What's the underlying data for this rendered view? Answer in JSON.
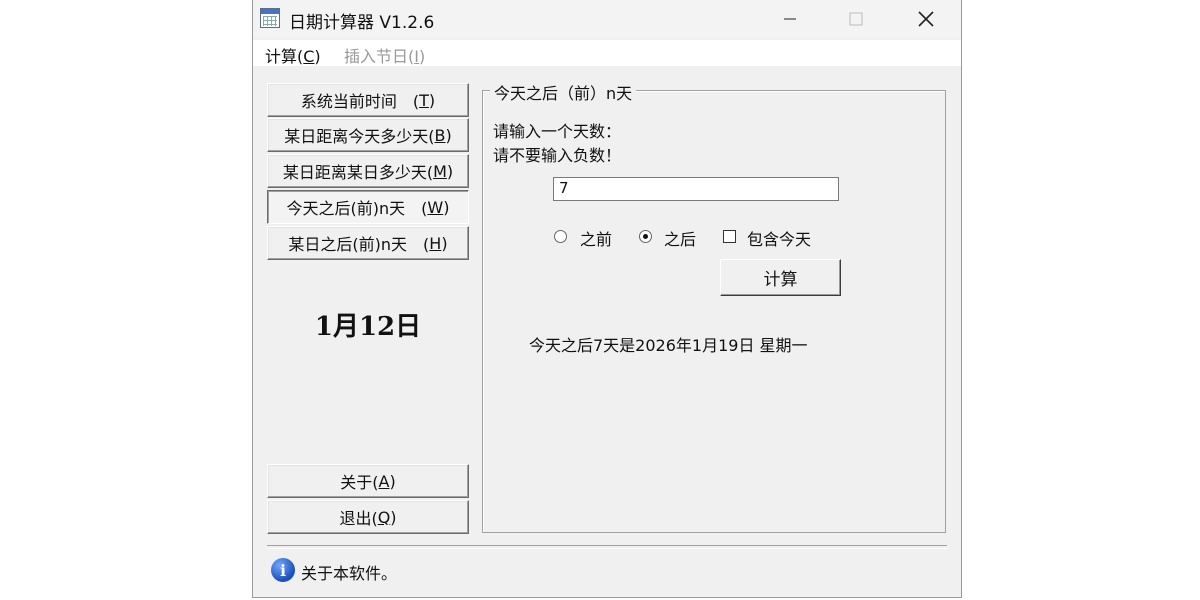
{
  "window": {
    "title": "日期计算器  V1.2.6",
    "icon": "calendar-app-icon",
    "controls": {
      "minimize": "—",
      "maximize": "☐",
      "close": "✕"
    }
  },
  "menu": {
    "calc_text": "计算(",
    "calc_key": "C",
    "calc_end": ")",
    "insert_text": "插入节日(",
    "insert_key": "I",
    "insert_end": ")"
  },
  "nav": [
    {
      "text": "系统当前时间　(",
      "key": "T",
      "end": ")"
    },
    {
      "text": "某日距离今天多少天(",
      "key": "B",
      "end": ")"
    },
    {
      "text": "某日距离某日多少天(",
      "key": "M",
      "end": ")"
    },
    {
      "text": "今天之后(前)n天　(",
      "key": "W",
      "end": ")"
    },
    {
      "text": "某日之后(前)n天　(",
      "key": "H",
      "end": ")"
    }
  ],
  "big_date": "1月12日",
  "bottom_buttons": [
    {
      "text": "关于(",
      "key": "A",
      "end": ")"
    },
    {
      "text": "退出(",
      "key": "Q",
      "end": ")"
    }
  ],
  "panel": {
    "title": "今天之后（前）n天",
    "prompt1": "请输入一个天数：",
    "prompt2": "请不要输入负数！",
    "days_value": "7",
    "radio_before": "之前",
    "radio_after": "之后",
    "checkbox_label": "包含今天",
    "calc_button": "计算",
    "result": "今天之后7天是2026年1月19日  星期一"
  },
  "state": {
    "selected_direction": "之后",
    "include_today": false
  },
  "status": {
    "icon": "info-icon",
    "icon_glyph": "i",
    "text": "关于本软件。"
  }
}
